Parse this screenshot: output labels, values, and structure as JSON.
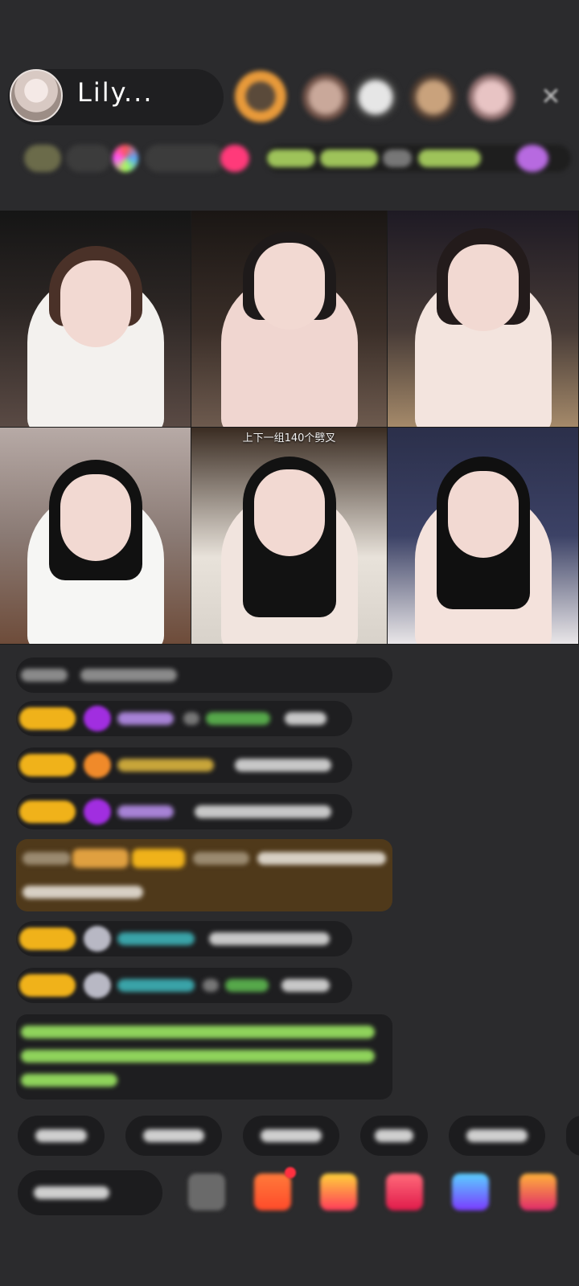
{
  "header": {
    "host_name": "Lily..."
  },
  "video": {
    "overlay_text": "上下一组140个劈叉"
  },
  "colors": {
    "background": "#2b2b2d",
    "badge_gold": "#f0b21a",
    "name_purple": "#a782d6",
    "name_teal": "#3aa3a8",
    "chat_green": "#8fd35b"
  }
}
